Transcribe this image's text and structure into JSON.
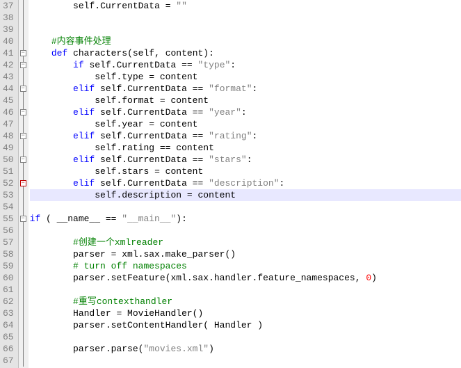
{
  "lineStart": 37,
  "lines": [
    {
      "indent": 2,
      "fold": "line",
      "tokens": [
        {
          "t": "self",
          "c": "self"
        },
        {
          "t": "op",
          "c": "."
        },
        {
          "t": "id",
          "c": "CurrentData "
        },
        {
          "t": "op",
          "c": "= "
        },
        {
          "t": "str",
          "c": "\"\""
        }
      ]
    },
    {
      "indent": 0,
      "fold": "line",
      "tokens": []
    },
    {
      "indent": 0,
      "fold": "line",
      "tokens": []
    },
    {
      "indent": 1,
      "fold": "line",
      "tokens": [
        {
          "t": "com",
          "c": "#内容事件处理"
        }
      ]
    },
    {
      "indent": 1,
      "fold": "box",
      "tokens": [
        {
          "t": "kw",
          "c": "def "
        },
        {
          "t": "fn",
          "c": "characters"
        },
        {
          "t": "op",
          "c": "("
        },
        {
          "t": "self",
          "c": "self"
        },
        {
          "t": "op",
          "c": ", content):"
        }
      ]
    },
    {
      "indent": 2,
      "fold": "box",
      "tokens": [
        {
          "t": "kw",
          "c": "if "
        },
        {
          "t": "self",
          "c": "self"
        },
        {
          "t": "op",
          "c": ".CurrentData "
        },
        {
          "t": "op",
          "c": "== "
        },
        {
          "t": "str",
          "c": "\"type\""
        },
        {
          "t": "op",
          "c": ":"
        }
      ]
    },
    {
      "indent": 3,
      "fold": "line",
      "tokens": [
        {
          "t": "self",
          "c": "self"
        },
        {
          "t": "op",
          "c": ".type "
        },
        {
          "t": "op",
          "c": "= content"
        }
      ]
    },
    {
      "indent": 2,
      "fold": "box",
      "tokens": [
        {
          "t": "kw",
          "c": "elif "
        },
        {
          "t": "self",
          "c": "self"
        },
        {
          "t": "op",
          "c": ".CurrentData "
        },
        {
          "t": "op",
          "c": "== "
        },
        {
          "t": "str",
          "c": "\"format\""
        },
        {
          "t": "op",
          "c": ":"
        }
      ]
    },
    {
      "indent": 3,
      "fold": "line",
      "tokens": [
        {
          "t": "self",
          "c": "self"
        },
        {
          "t": "op",
          "c": ".format "
        },
        {
          "t": "op",
          "c": "= content"
        }
      ]
    },
    {
      "indent": 2,
      "fold": "box",
      "tokens": [
        {
          "t": "kw",
          "c": "elif "
        },
        {
          "t": "self",
          "c": "self"
        },
        {
          "t": "op",
          "c": ".CurrentData "
        },
        {
          "t": "op",
          "c": "== "
        },
        {
          "t": "str",
          "c": "\"year\""
        },
        {
          "t": "op",
          "c": ":"
        }
      ]
    },
    {
      "indent": 3,
      "fold": "line",
      "tokens": [
        {
          "t": "self",
          "c": "self"
        },
        {
          "t": "op",
          "c": ".year "
        },
        {
          "t": "op",
          "c": "= content"
        }
      ]
    },
    {
      "indent": 2,
      "fold": "box",
      "tokens": [
        {
          "t": "kw",
          "c": "elif "
        },
        {
          "t": "self",
          "c": "self"
        },
        {
          "t": "op",
          "c": ".CurrentData "
        },
        {
          "t": "op",
          "c": "== "
        },
        {
          "t": "str",
          "c": "\"rating\""
        },
        {
          "t": "op",
          "c": ":"
        }
      ]
    },
    {
      "indent": 3,
      "fold": "line",
      "tokens": [
        {
          "t": "self",
          "c": "self"
        },
        {
          "t": "op",
          "c": ".rating "
        },
        {
          "t": "op",
          "c": "== content"
        }
      ]
    },
    {
      "indent": 2,
      "fold": "box",
      "tokens": [
        {
          "t": "kw",
          "c": "elif "
        },
        {
          "t": "self",
          "c": "self"
        },
        {
          "t": "op",
          "c": ".CurrentData "
        },
        {
          "t": "op",
          "c": "== "
        },
        {
          "t": "str",
          "c": "\"stars\""
        },
        {
          "t": "op",
          "c": ":"
        }
      ]
    },
    {
      "indent": 3,
      "fold": "line",
      "tokens": [
        {
          "t": "self",
          "c": "self"
        },
        {
          "t": "op",
          "c": ".stars "
        },
        {
          "t": "op",
          "c": "= content"
        }
      ]
    },
    {
      "indent": 2,
      "fold": "boxred",
      "tokens": [
        {
          "t": "kw",
          "c": "elif "
        },
        {
          "t": "self",
          "c": "self"
        },
        {
          "t": "op",
          "c": ".CurrentData "
        },
        {
          "t": "op",
          "c": "== "
        },
        {
          "t": "str",
          "c": "\"description\""
        },
        {
          "t": "op",
          "c": ":"
        }
      ]
    },
    {
      "indent": 3,
      "fold": "line",
      "hl": true,
      "tokens": [
        {
          "t": "self",
          "c": "self"
        },
        {
          "t": "op",
          "c": ".description "
        },
        {
          "t": "op",
          "c": "= content"
        }
      ]
    },
    {
      "indent": 0,
      "fold": "line",
      "tokens": []
    },
    {
      "indent": 0,
      "fold": "box",
      "tokens": [
        {
          "t": "kw",
          "c": "if "
        },
        {
          "t": "op",
          "c": "( __name__ "
        },
        {
          "t": "op",
          "c": "== "
        },
        {
          "t": "str",
          "c": "\"__main__\""
        },
        {
          "t": "op",
          "c": "):"
        }
      ]
    },
    {
      "indent": 0,
      "fold": "line",
      "tokens": []
    },
    {
      "indent": 2,
      "fold": "line",
      "tokens": [
        {
          "t": "com",
          "c": "#创建一个xmlreader"
        }
      ]
    },
    {
      "indent": 2,
      "fold": "line",
      "tokens": [
        {
          "t": "id",
          "c": "parser "
        },
        {
          "t": "op",
          "c": "= xml.sax.make_parser"
        },
        {
          "t": "op",
          "c": "()"
        }
      ]
    },
    {
      "indent": 2,
      "fold": "line",
      "tokens": [
        {
          "t": "com",
          "c": "# turn off namespaces"
        }
      ]
    },
    {
      "indent": 2,
      "fold": "line",
      "tokens": [
        {
          "t": "id",
          "c": "parser.setFeature"
        },
        {
          "t": "op",
          "c": "(xml.sax.handler.feature_namespaces, "
        },
        {
          "t": "num",
          "c": "0"
        },
        {
          "t": "op",
          "c": ")"
        }
      ]
    },
    {
      "indent": 0,
      "fold": "line",
      "tokens": []
    },
    {
      "indent": 2,
      "fold": "line",
      "tokens": [
        {
          "t": "com",
          "c": "#重写contexthandler"
        }
      ]
    },
    {
      "indent": 2,
      "fold": "line",
      "tokens": [
        {
          "t": "id",
          "c": "Handler "
        },
        {
          "t": "op",
          "c": "= MovieHandler"
        },
        {
          "t": "op",
          "c": "()"
        }
      ]
    },
    {
      "indent": 2,
      "fold": "line",
      "tokens": [
        {
          "t": "id",
          "c": "parser.setContentHandler"
        },
        {
          "t": "op",
          "c": "( Handler )"
        }
      ]
    },
    {
      "indent": 0,
      "fold": "line",
      "tokens": []
    },
    {
      "indent": 2,
      "fold": "line",
      "tokens": [
        {
          "t": "id",
          "c": "parser.parse"
        },
        {
          "t": "op",
          "c": "("
        },
        {
          "t": "str",
          "c": "\"movies.xml\""
        },
        {
          "t": "op",
          "c": ")"
        }
      ]
    },
    {
      "indent": 0,
      "fold": "line",
      "tokens": []
    }
  ]
}
